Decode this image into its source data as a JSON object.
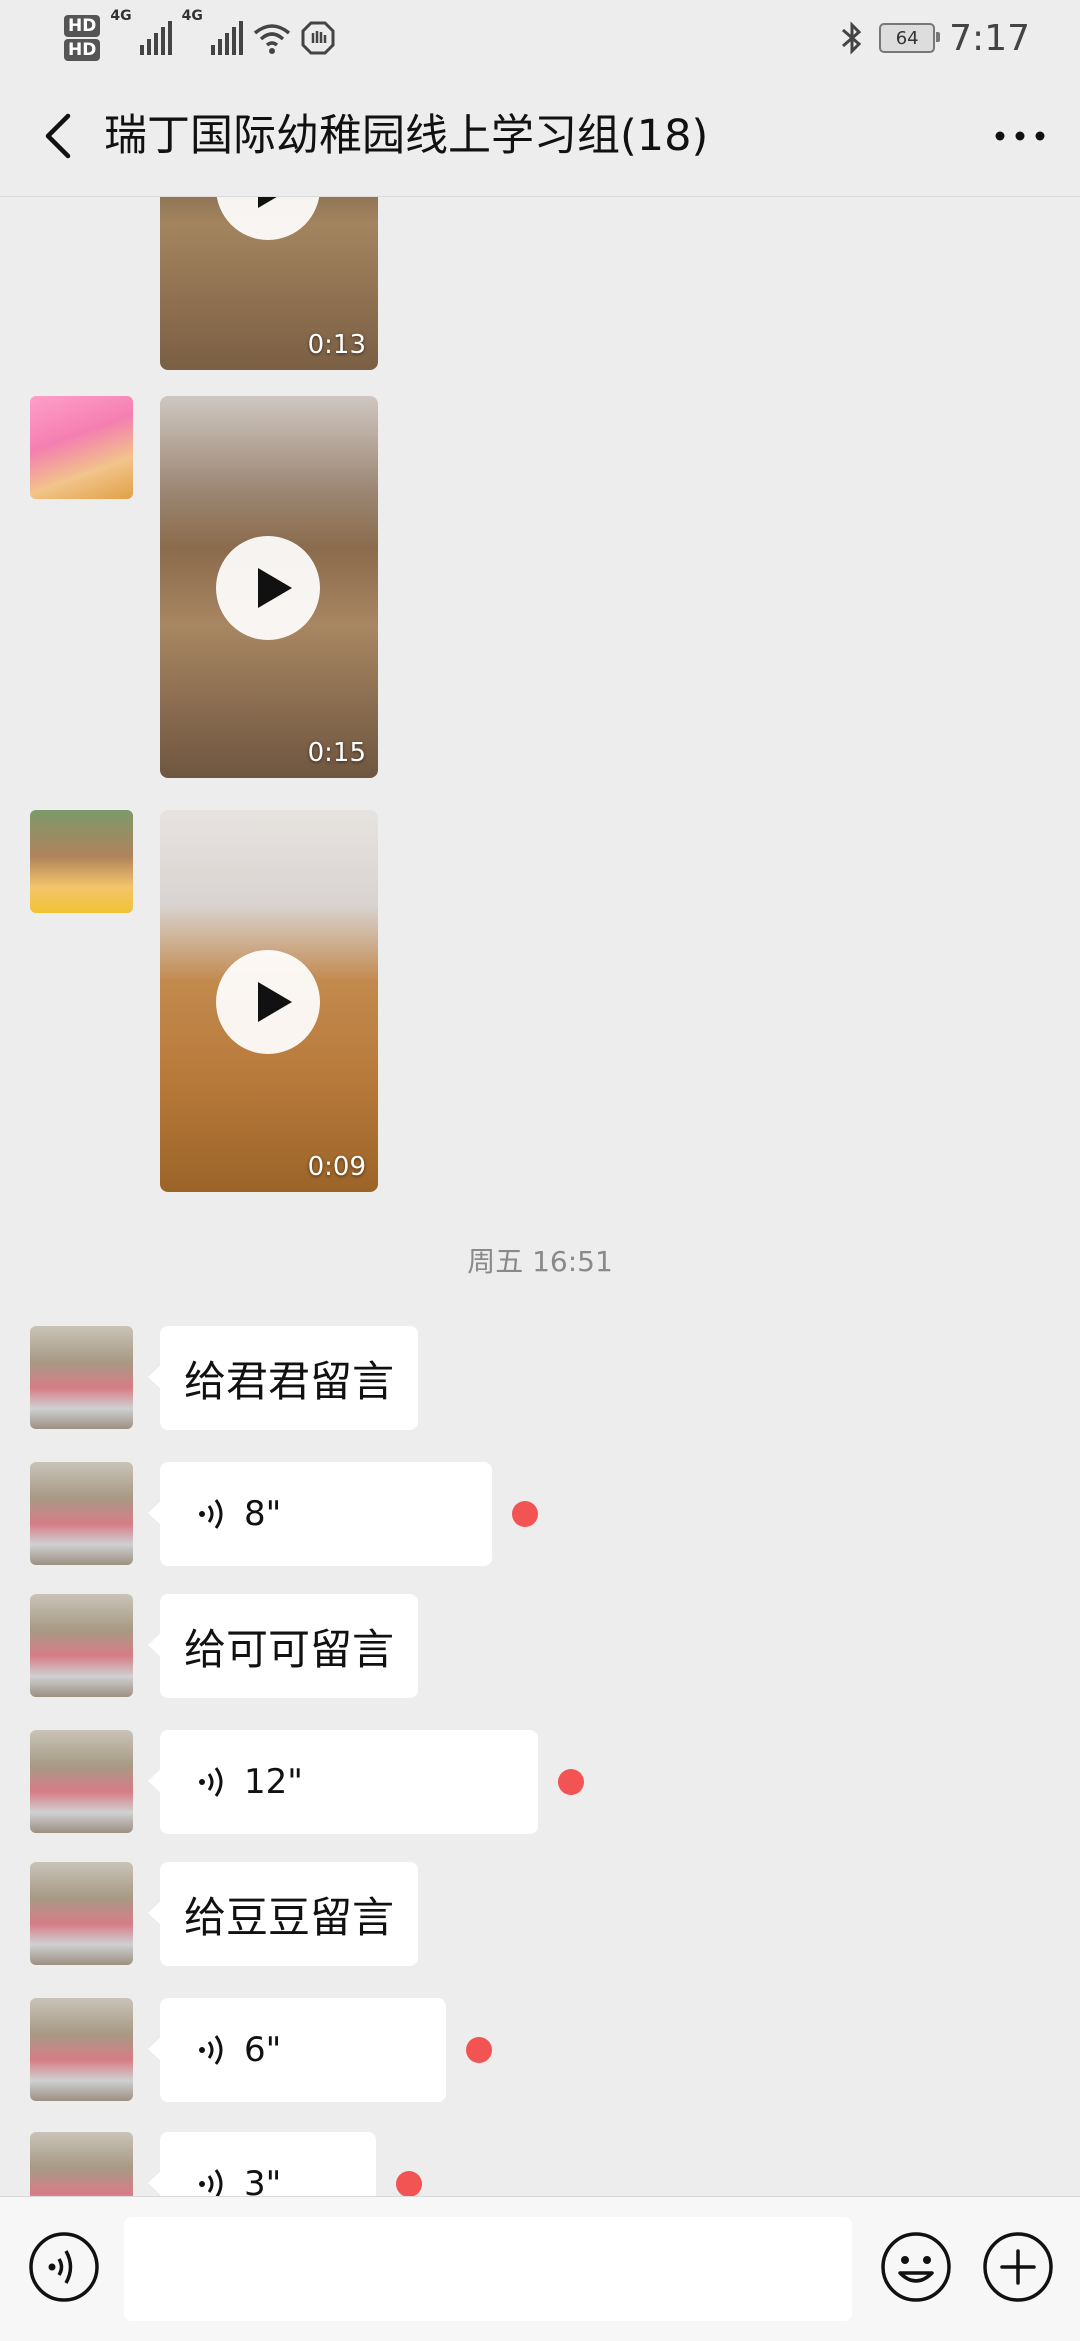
{
  "status_bar": {
    "hd1": "HD",
    "hd2": "HD",
    "network1": "4G",
    "network2": "4G",
    "battery": "64",
    "time": "7:17",
    "icons": [
      "bluetooth-icon",
      "wifi-icon",
      "signal-icon",
      "hand-icon",
      "battery-icon"
    ]
  },
  "header": {
    "title": "瑞丁国际幼稚园线上学习组(18)",
    "back_icon": "back-chevron-icon",
    "more_icon": "more-dots-icon"
  },
  "messages": [
    {
      "type": "video",
      "duration": "0:13"
    },
    {
      "type": "video",
      "duration": "0:15"
    },
    {
      "type": "video",
      "duration": "0:09"
    },
    {
      "type": "timestamp",
      "text": "周五 16:51"
    },
    {
      "type": "text",
      "text": "给君君留言"
    },
    {
      "type": "voice",
      "length": "8\"",
      "unread": true
    },
    {
      "type": "text",
      "text": "给可可留言"
    },
    {
      "type": "voice",
      "length": "12\"",
      "unread": true
    },
    {
      "type": "text",
      "text": "给豆豆留言"
    },
    {
      "type": "voice",
      "length": "6\"",
      "unread": true
    },
    {
      "type": "voice",
      "length": "3\"",
      "unread": true
    }
  ],
  "input_bar": {
    "placeholder": "",
    "icons": [
      "voice-toggle-icon",
      "emoji-icon",
      "plus-icon"
    ]
  },
  "colors": {
    "background": "#ededed",
    "bubble": "#ffffff",
    "unread_dot": "#f25353",
    "timestamp_text": "#8a8a8a"
  }
}
